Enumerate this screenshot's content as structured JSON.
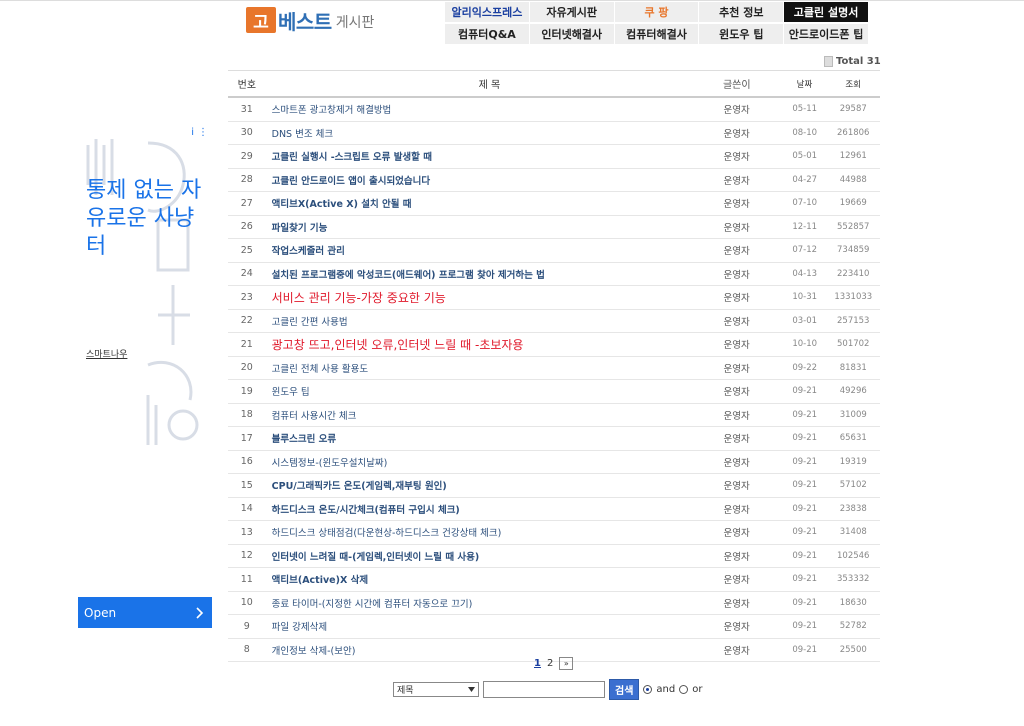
{
  "logo": {
    "mark": "고",
    "main": "베스트",
    "sub": "게시판"
  },
  "nav": {
    "row1": [
      {
        "label": "알리익스프레스",
        "style": "blue"
      },
      {
        "label": "자유게시판",
        "style": ""
      },
      {
        "label": "쿠 팡",
        "style": "orange"
      },
      {
        "label": "추천 정보",
        "style": ""
      },
      {
        "label": "고클린 설명서",
        "style": "dark"
      }
    ],
    "row2": [
      {
        "label": "컴퓨터Q&A",
        "style": ""
      },
      {
        "label": "인터넷해결사",
        "style": ""
      },
      {
        "label": "컴퓨터해결사",
        "style": ""
      },
      {
        "label": "윈도우 팁",
        "style": ""
      },
      {
        "label": "안드로이드폰 팁",
        "style": ""
      }
    ]
  },
  "ad": {
    "title": "통제 없는 자유로운 사냥터",
    "brand": "스마트나우",
    "open": "Open",
    "info_icon": "i",
    "menu_icon": "⋮"
  },
  "total": "Total 31",
  "headers": {
    "num": "번호",
    "title": "제    목",
    "writer": "글쓴이",
    "date": "날짜",
    "views": "조회"
  },
  "rows": [
    {
      "num": "31",
      "title": "스마트폰 광고창제거 해결방법",
      "style": "blue",
      "writer": "운영자",
      "date": "05-11",
      "views": "29587"
    },
    {
      "num": "30",
      "title": "DNS 변조 체크",
      "style": "blue",
      "writer": "운영자",
      "date": "08-10",
      "views": "261806"
    },
    {
      "num": "29",
      "title": "고클린 실행시 -스크립트 오류 발생할 때",
      "style": "bold",
      "writer": "운영자",
      "date": "05-01",
      "views": "12961"
    },
    {
      "num": "28",
      "title": "고클린 안드로이드 앱이 출시되었습니다",
      "style": "bold",
      "writer": "운영자",
      "date": "04-27",
      "views": "44988"
    },
    {
      "num": "27",
      "title": "액티브X(Active X) 설치 안될 때",
      "style": "bold",
      "writer": "운영자",
      "date": "07-10",
      "views": "19669"
    },
    {
      "num": "26",
      "title": "파일찾기 기능",
      "style": "bold",
      "writer": "운영자",
      "date": "12-11",
      "views": "552857"
    },
    {
      "num": "25",
      "title": "작업스케줄러 관리",
      "style": "bold",
      "writer": "운영자",
      "date": "07-12",
      "views": "734859"
    },
    {
      "num": "24",
      "title": "설치된 프로그램중에 악성코드(애드웨어) 프로그램 찾아 제거하는 법",
      "style": "bold",
      "writer": "운영자",
      "date": "04-13",
      "views": "223410"
    },
    {
      "num": "23",
      "title": "서비스 관리 기능-가장 중요한 기능",
      "style": "red",
      "writer": "운영자",
      "date": "10-31",
      "views": "1331033"
    },
    {
      "num": "22",
      "title": "고클린 간편 사용법",
      "style": "blue",
      "writer": "운영자",
      "date": "03-01",
      "views": "257153"
    },
    {
      "num": "21",
      "title": "광고창 뜨고,인터넷 오류,인터넷 느릴 때 -초보자용",
      "style": "red",
      "writer": "운영자",
      "date": "10-10",
      "views": "501702"
    },
    {
      "num": "20",
      "title": "고클린 전체 사용 활용도",
      "style": "blue",
      "writer": "운영자",
      "date": "09-22",
      "views": "81831"
    },
    {
      "num": "19",
      "title": "윈도우 팁",
      "style": "blue",
      "writer": "운영자",
      "date": "09-21",
      "views": "49296"
    },
    {
      "num": "18",
      "title": "컴퓨터 사용시간 체크",
      "style": "blue",
      "writer": "운영자",
      "date": "09-21",
      "views": "31009"
    },
    {
      "num": "17",
      "title": "블루스크린 오류",
      "style": "bold",
      "writer": "운영자",
      "date": "09-21",
      "views": "65631"
    },
    {
      "num": "16",
      "title": "시스템정보-(윈도우설치날짜)",
      "style": "blue",
      "writer": "운영자",
      "date": "09-21",
      "views": "19319"
    },
    {
      "num": "15",
      "title": "CPU/그래픽카드 온도(게임렉,재부팅 원인)",
      "style": "bold",
      "writer": "운영자",
      "date": "09-21",
      "views": "57102"
    },
    {
      "num": "14",
      "title": "하드디스크 온도/시간체크(컴퓨터 구입시 체크)",
      "style": "bold",
      "writer": "운영자",
      "date": "09-21",
      "views": "23838"
    },
    {
      "num": "13",
      "title": "하드디스크 상태점검(다운현상-하드디스크 건강상태 체크)",
      "style": "blue",
      "writer": "운영자",
      "date": "09-21",
      "views": "31408"
    },
    {
      "num": "12",
      "title": "인터넷이 느려질 때-(게임렉,인터넷이 느릴 때 사용)",
      "style": "bold",
      "writer": "운영자",
      "date": "09-21",
      "views": "102546"
    },
    {
      "num": "11",
      "title": "액티브(Active)X 삭제",
      "style": "bold",
      "writer": "운영자",
      "date": "09-21",
      "views": "353332"
    },
    {
      "num": "10",
      "title": "종료 타이머-(지정한 시간에 컴퓨터 자동으로 끄기)",
      "style": "blue",
      "writer": "운영자",
      "date": "09-21",
      "views": "18630"
    },
    {
      "num": "9",
      "title": "파일 강제삭제",
      "style": "blue",
      "writer": "운영자",
      "date": "09-21",
      "views": "52782"
    },
    {
      "num": "8",
      "title": "개인정보 삭제-(보안)",
      "style": "blue",
      "writer": "운영자",
      "date": "09-21",
      "views": "25500"
    }
  ],
  "pagination": {
    "pages": [
      "1",
      "2"
    ],
    "current": "1",
    "next": "»"
  },
  "search": {
    "field": "제목",
    "button": "검색",
    "and_label": "and",
    "or_label": "or",
    "selected": "and"
  }
}
